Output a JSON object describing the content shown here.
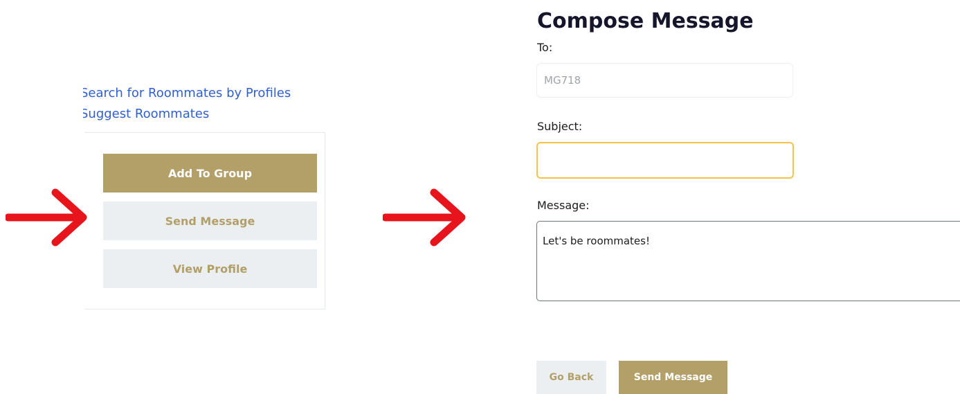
{
  "left_panel": {
    "links": {
      "search_profiles": "Search for Roommates by Profiles",
      "suggest_roommates": "Suggest Roommates"
    },
    "card": {
      "add_to_group": "Add To Group",
      "send_message": "Send Message",
      "view_profile": "View Profile"
    }
  },
  "compose": {
    "title": "Compose Message",
    "to_label": "To:",
    "to_value": "MG718",
    "subject_label": "Subject:",
    "subject_value": "",
    "message_label": "Message:",
    "message_value": "Let's be roommates!",
    "go_back": "Go Back",
    "send_message": "Send Message"
  },
  "icons": {
    "arrow_left": "arrow-right-icon",
    "arrow_middle": "arrow-right-icon"
  },
  "colors": {
    "primary_gold": "#b39f68",
    "secondary_bg": "#ebeff2",
    "link_blue": "#2f5fd0",
    "arrow_red": "#e8141c",
    "subject_focus": "#f5c24a"
  }
}
